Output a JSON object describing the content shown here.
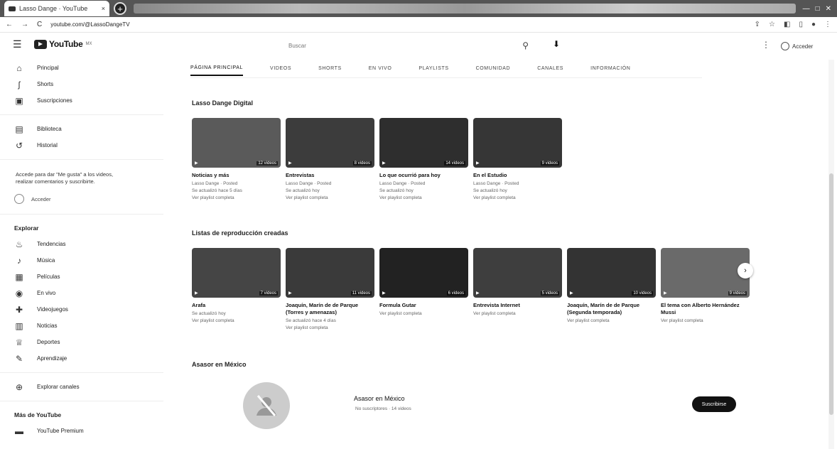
{
  "browser": {
    "tab_title": "Lasso Dange · YouTube",
    "new_tab": "+",
    "url": "youtube.com/@LassoDangeTV",
    "nav_back": "←",
    "nav_forward": "→",
    "nav_reload": "C"
  },
  "header": {
    "logo_text": "YouTube",
    "logo_sup": "MX",
    "search_placeholder": "Buscar",
    "signin_label": "Acceder"
  },
  "sidebar": {
    "main": [
      {
        "label": "Principal",
        "icon": "home-icon",
        "glyph": "⌂"
      },
      {
        "label": "Shorts",
        "icon": "shorts-icon",
        "glyph": "ʃ"
      },
      {
        "label": "Suscripciones",
        "icon": "subscriptions-icon",
        "glyph": "▣"
      }
    ],
    "you": [
      {
        "label": "Biblioteca",
        "icon": "library-icon",
        "glyph": "▤"
      },
      {
        "label": "Historial",
        "icon": "history-icon",
        "glyph": "↺"
      }
    ],
    "promo_text": "Accede para dar \"Me gusta\" a los videos, realizar comentarios y suscribirte.",
    "promo_button": "Acceder",
    "explore_title": "Explorar",
    "explore": [
      {
        "label": "Tendencias",
        "icon": "trending-icon",
        "glyph": "♨"
      },
      {
        "label": "Música",
        "icon": "music-icon",
        "glyph": "♪"
      },
      {
        "label": "Películas",
        "icon": "movies-icon",
        "glyph": "▦"
      },
      {
        "label": "En vivo",
        "icon": "live-icon",
        "glyph": "◉"
      },
      {
        "label": "Videojuegos",
        "icon": "gaming-icon",
        "glyph": "✚"
      },
      {
        "label": "Noticias",
        "icon": "news-icon",
        "glyph": "▥"
      },
      {
        "label": "Deportes",
        "icon": "sports-icon",
        "glyph": "♕"
      },
      {
        "label": "Aprendizaje",
        "icon": "learning-icon",
        "glyph": "✎"
      }
    ],
    "browse_channels": "Explorar canales",
    "more_title": "Más de YouTube",
    "more": [
      {
        "label": "YouTube Premium",
        "icon": "premium-icon",
        "glyph": "▬"
      }
    ]
  },
  "channel_tabs": [
    {
      "label": "PÁGINA PRINCIPAL",
      "active": true
    },
    {
      "label": "VIDEOS",
      "active": false
    },
    {
      "label": "SHORTS",
      "active": false
    },
    {
      "label": "EN VIVO",
      "active": false
    },
    {
      "label": "PLAYLISTS",
      "active": false
    },
    {
      "label": "COMUNIDAD",
      "active": false
    },
    {
      "label": "CANALES",
      "active": false
    },
    {
      "label": "INFORMACIÓN",
      "active": false
    }
  ],
  "section1": {
    "title": "Lasso Dange Digital",
    "cards": [
      {
        "title": "Noticias y más",
        "meta1": "Lasso Dange · Posted",
        "meta2": "Se actualizó hace 5 días",
        "meta3": "Ver playlist completa",
        "duration": "12 videos",
        "color": "#5a5a5a"
      },
      {
        "title": "Entrevistas",
        "meta1": "Lasso Dange · Posted",
        "meta2": "Se actualizó hoy",
        "meta3": "Ver playlist completa",
        "duration": "8 videos",
        "color": "#3c3c3c"
      },
      {
        "title": "Lo que ocurrió para hoy",
        "meta1": "Lasso Dange · Posted",
        "meta2": "Se actualizó hoy",
        "meta3": "Ver playlist completa",
        "duration": "14 videos",
        "color": "#2e2e2e"
      },
      {
        "title": "En el Estudio",
        "meta1": "Lasso Dange · Posted",
        "meta2": "Se actualizó hoy",
        "meta3": "Ver playlist completa",
        "duration": "9 videos",
        "color": "#363636"
      }
    ]
  },
  "section2": {
    "title": "Listas de reproducción creadas",
    "cards": [
      {
        "title": "Arafa",
        "meta1": "Se actualizó hoy",
        "meta2": "Ver playlist completa",
        "meta3": "",
        "duration": "7 videos",
        "color": "#454545"
      },
      {
        "title": "Joaquín, Marín de de Parque (Torres y amenazas)",
        "meta1": "Se actualizó hace 4 días",
        "meta2": "Ver playlist completa",
        "meta3": "",
        "duration": "11 videos",
        "color": "#3a3a3a"
      },
      {
        "title": "Formula Gutar",
        "meta1": "Ver playlist completa",
        "meta2": "",
        "meta3": "",
        "duration": "6 videos",
        "color": "#222222"
      },
      {
        "title": "Entrevista Internet",
        "meta1": "Ver playlist completa",
        "meta2": "",
        "meta3": "",
        "duration": "5 videos",
        "color": "#3e3e3e"
      },
      {
        "title": "Joaquín, Marín de de Parque (Segunda temporada)",
        "meta1": "Ver playlist completa",
        "meta2": "",
        "meta3": "",
        "duration": "10 videos",
        "color": "#333333"
      },
      {
        "title": "El tema con Alberto Hernández Mussi",
        "meta1": "Ver playlist completa",
        "meta2": "",
        "meta3": "",
        "duration": "9 videos",
        "color": "#6a6a6a"
      }
    ]
  },
  "section3": {
    "title": "Asasor en México",
    "channel_name": "Asasor en México",
    "channel_meta": "No suscriptores · 14 videos",
    "subscribe_label": "Suscribirse"
  },
  "icons": {
    "menu": "☰",
    "search": "⚲",
    "mic": "🎙",
    "more": "⋮",
    "next": "›"
  }
}
